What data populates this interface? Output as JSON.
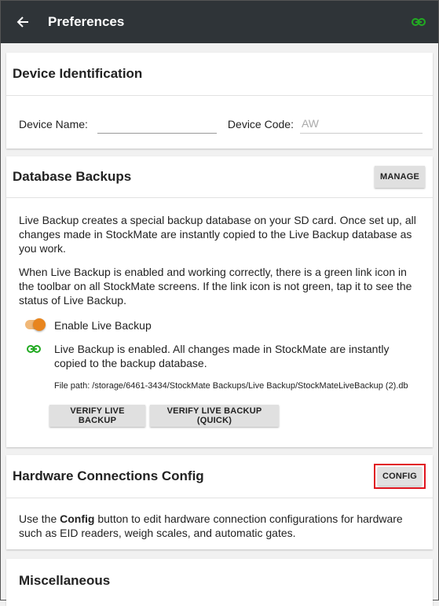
{
  "appbar": {
    "title": "Preferences",
    "back_icon": "arrow-left-icon",
    "status_icon": "link-icon",
    "status_color": "#22aa22"
  },
  "device_identification": {
    "title": "Device Identification",
    "device_name_label": "Device Name:",
    "device_name_value": "",
    "device_code_label": "Device Code:",
    "device_code_placeholder": "AW"
  },
  "database_backups": {
    "title": "Database Backups",
    "manage_label": "MANAGE",
    "para1": "Live Backup creates a special backup database on your SD card. Once set up, all changes made in StockMate are instantly copied to the Live Backup database as you work.",
    "para2": "When Live Backup is enabled and working correctly, there is a green link icon in the toolbar on all StockMate screens. If the link icon is not green, tap it to see the status of Live Backup.",
    "toggle_label": "Enable Live Backup",
    "toggle_on": true,
    "status_text": "Live Backup is enabled. All changes made in StockMate are instantly copied to the backup database.",
    "file_path": "File path: /storage/6461-3434/StockMate Backups/Live Backup/StockMateLiveBackup (2).db",
    "verify_label": "VERIFY LIVE BACKUP",
    "verify_quick_label": "VERIFY LIVE BACKUP (QUICK)",
    "accent_color": "#e8851e"
  },
  "hardware": {
    "title": "Hardware Connections Config",
    "config_label": "CONFIG",
    "text_prefix": "Use the ",
    "text_bold": "Config",
    "text_suffix": " button to edit hardware connection configurations for hardware such as EID readers, weigh scales, and automatic gates."
  },
  "misc": {
    "title": "Miscellaneous"
  }
}
